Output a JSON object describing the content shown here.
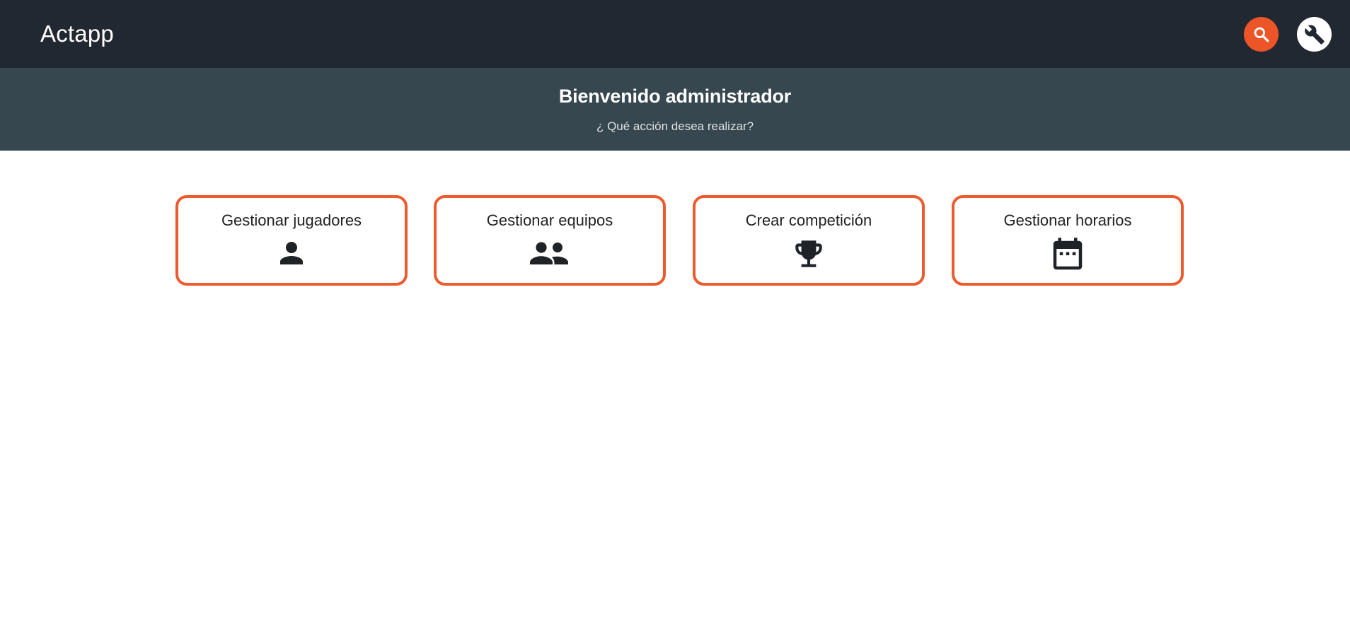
{
  "header": {
    "app_title": "Actapp",
    "search_icon": "search-icon",
    "settings_icon": "wrench-icon",
    "colors": {
      "background": "#222831",
      "search_button": "#ec5528",
      "settings_button": "#ffffff"
    }
  },
  "hero": {
    "title": "Bienvenido administrador",
    "subtitle": "¿ Qué acción desea realizar?",
    "background": "#37474f"
  },
  "actions": [
    {
      "label": "Gestionar jugadores",
      "icon": "person-icon"
    },
    {
      "label": "Gestionar equipos",
      "icon": "group-icon"
    },
    {
      "label": "Crear competición",
      "icon": "trophy-icon"
    },
    {
      "label": "Gestionar horarios",
      "icon": "calendar-icon"
    }
  ],
  "accent_color": "#ec5b2d"
}
